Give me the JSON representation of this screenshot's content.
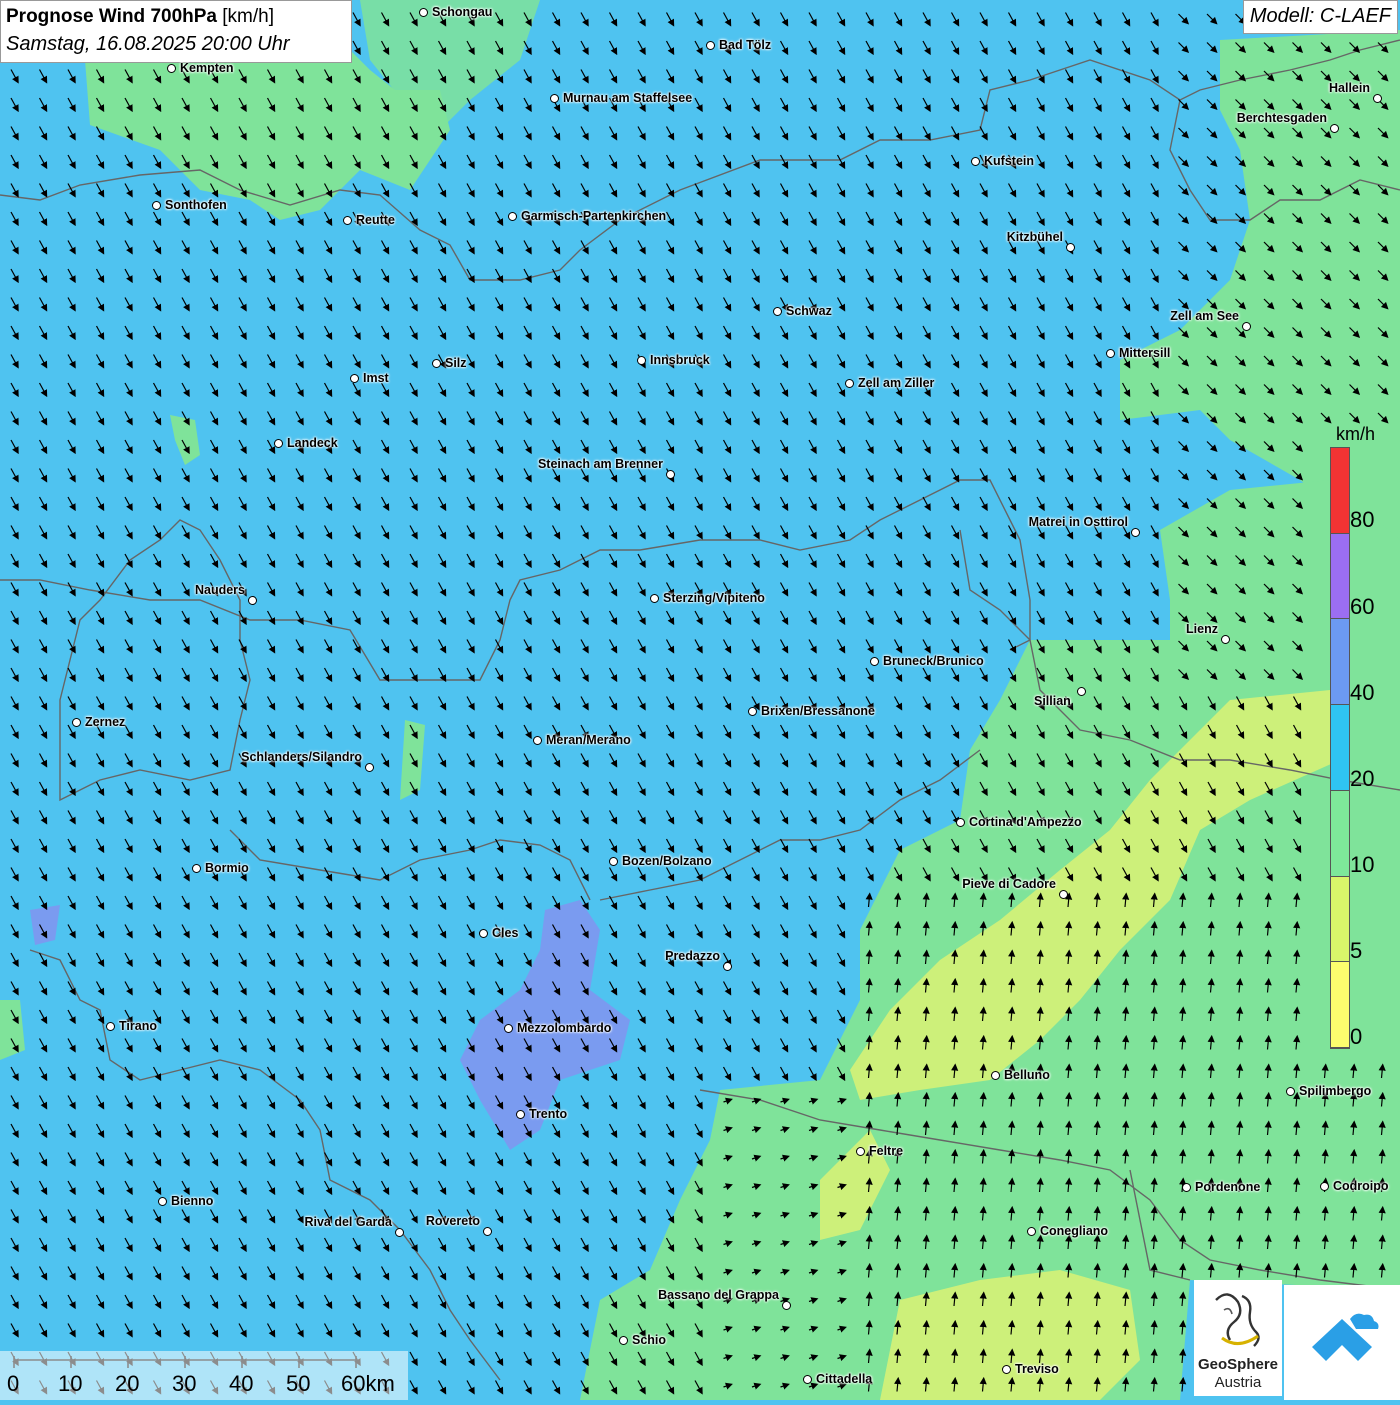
{
  "header": {
    "title_bold": "Prognose Wind 700hPa",
    "title_unit": " [km/h]",
    "subtitle": "Samstag, 16.08.2025 20:00 Uhr"
  },
  "model": "Modell: C-LAEF",
  "legend": {
    "unit": "km/h",
    "labels": [
      "80",
      "60",
      "40",
      "20",
      "10",
      "5",
      "0"
    ],
    "colors": [
      "#f23333",
      "#9b6ef2",
      "#6c9af2",
      "#2fc4f2",
      "#7ee89a",
      "#d9f56a",
      "#fdfd6e"
    ]
  },
  "scale": {
    "labels": [
      "0",
      "10",
      "20",
      "30",
      "40",
      "50",
      "60km"
    ]
  },
  "cities": [
    {
      "name": "Schongau"
    },
    {
      "name": "Bad Tölz"
    },
    {
      "name": "Kempten"
    },
    {
      "name": "Murnau am Staffelsee"
    },
    {
      "name": "Hallein"
    },
    {
      "name": "Berchtesgaden"
    },
    {
      "name": "Kufstein"
    },
    {
      "name": "Sonthofen"
    },
    {
      "name": "Reutte"
    },
    {
      "name": "Garmisch-Partenkirchen"
    },
    {
      "name": "Kitzbühel"
    },
    {
      "name": "Schwaz"
    },
    {
      "name": "Zell am See"
    },
    {
      "name": "Mittersill"
    },
    {
      "name": "Innsbruck"
    },
    {
      "name": "Silz"
    },
    {
      "name": "Imst"
    },
    {
      "name": "Zell am Ziller"
    },
    {
      "name": "Landeck"
    },
    {
      "name": "Steinach am Brenner"
    },
    {
      "name": "Matrei in Osttirol"
    },
    {
      "name": "Nauders"
    },
    {
      "name": "Sterzing/Vipiteno"
    },
    {
      "name": "Lienz"
    },
    {
      "name": "Bruneck/Brunico"
    },
    {
      "name": "Sillian"
    },
    {
      "name": "Brixen/Bressanone"
    },
    {
      "name": "Zernez"
    },
    {
      "name": "Meran/Merano"
    },
    {
      "name": "Schlanders/Silandro"
    },
    {
      "name": "Cortina d'Ampezzo"
    },
    {
      "name": "Bozen/Bolzano"
    },
    {
      "name": "Bormio"
    },
    {
      "name": "Pieve di Cadore"
    },
    {
      "name": "Cles"
    },
    {
      "name": "Predazzo"
    },
    {
      "name": "Mezzolombardo"
    },
    {
      "name": "Tirano"
    },
    {
      "name": "Belluno"
    },
    {
      "name": "Spilimbergo"
    },
    {
      "name": "Trento"
    },
    {
      "name": "Feltre"
    },
    {
      "name": "Pordenone"
    },
    {
      "name": "Codroipo"
    },
    {
      "name": "Bienno"
    },
    {
      "name": "Riva del Garda"
    },
    {
      "name": "Rovereto"
    },
    {
      "name": "Conegliano"
    },
    {
      "name": "Bassano del Grappa"
    },
    {
      "name": "Schio"
    },
    {
      "name": "Treviso"
    },
    {
      "name": "Cittadella"
    }
  ],
  "logos": {
    "geosphere_line1": "GeoSphere",
    "geosphere_line2": "Austria"
  }
}
